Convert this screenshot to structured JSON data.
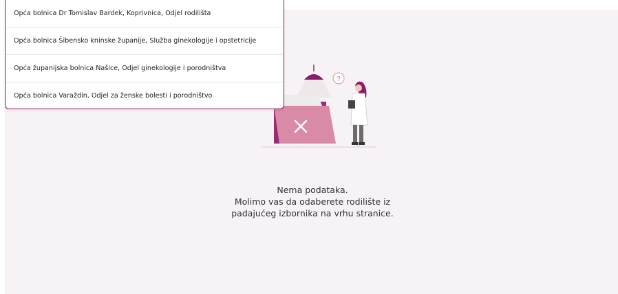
{
  "hospital_dropdown": {
    "options": [
      "Opća bolnica Dr Tomislav Bardek, Koprivnica, Odjel rodilišta",
      "Opća bolnica Šibensko kninske županije, Služba ginekologije i opstetricije",
      "Opća županijska bolnica Našice, Odjel ginekologije i porodništva",
      "Opća bolnica Varaždin, Odjel za ženske bolesti i porodništvo"
    ]
  },
  "empty_state": {
    "illustration": "empty-folder-doctor-illustration",
    "question_glyph": "?",
    "line1": "Nema podataka.",
    "line2": "Molimo vas da odaberete rodilište iz",
    "line3": "padajućeg izbornika na vrhu stranice."
  },
  "colors": {
    "accent": "#8a1d6b",
    "folder_pink": "#d98aa6",
    "panel_background": "#f7f2f6"
  }
}
